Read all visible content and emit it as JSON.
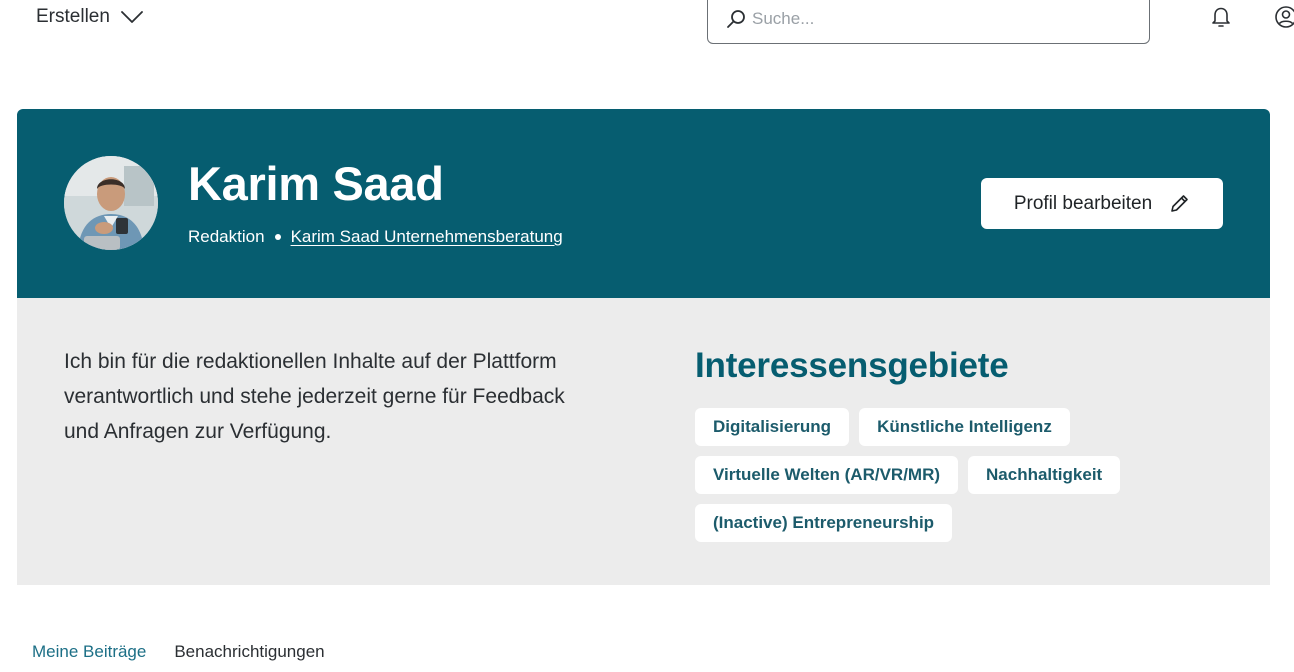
{
  "topbar": {
    "create_label": "Erstellen",
    "search_placeholder": "Suche..."
  },
  "profile": {
    "name": "Karim Saad",
    "role": "Redaktion",
    "company": "Karim Saad Unternehmensberatung",
    "edit_label": "Profil bearbeiten"
  },
  "about": {
    "bio": "Ich bin für die redaktionellen Inhalte auf der Plattform verantwortlich und stehe jederzeit gerne für Feedback und Anfragen zur Verfügung.",
    "interests_title": "Interessensgebiete",
    "tags": [
      "Digitalisierung",
      "Künstliche Intelligenz",
      "Virtuelle Welten (AR/VR/MR)",
      "Nachhaltigkeit",
      "(Inactive) Entrepreneurship"
    ]
  },
  "tabs": [
    {
      "label": "Meine Beiträge",
      "active": true
    },
    {
      "label": "Benachrichtigungen",
      "active": false
    }
  ],
  "colors": {
    "accent": "#065d70",
    "band": "#ececec"
  }
}
